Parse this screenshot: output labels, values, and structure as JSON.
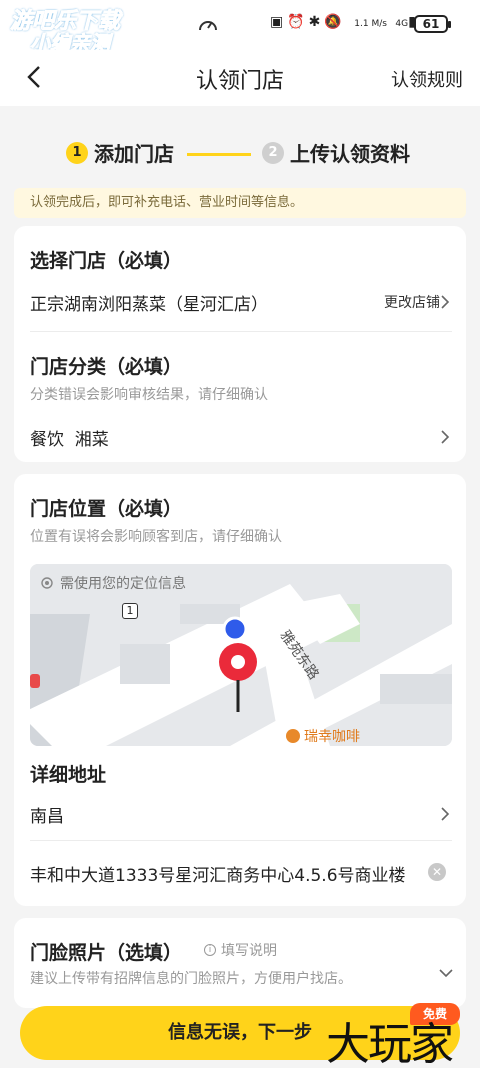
{
  "status_bar": {
    "battery": "61",
    "network": "4G",
    "speed": "1.1 M/s",
    "watermark_line1": "游吧乐下载",
    "watermark_line2": "小编亲测"
  },
  "nav": {
    "title": "认领门店",
    "rules_label": "认领规则"
  },
  "steps": [
    {
      "num": "1",
      "label": "添加门店",
      "active": true
    },
    {
      "num": "2",
      "label": "上传认领资料",
      "active": false
    }
  ],
  "notice": "认领完成后，即可补充电话、营业时间等信息。",
  "store_select": {
    "title": "选择门店（必填）",
    "store_name": "正宗湖南浏阳蒸菜（星河汇店）",
    "change_label": "更改店铺"
  },
  "category": {
    "title": "门店分类（必填）",
    "hint": "分类错误会影响审核结果，请仔细确认",
    "value": "餐饮  湘菜"
  },
  "location": {
    "title": "门店位置（必填）",
    "hint": "位置有误将会影响顾客到店，请仔细确认",
    "map_hint": "需使用您的定位信息",
    "road_label": "雅苑东路",
    "poi_label": "瑞幸咖啡",
    "road_badge": "1",
    "detail_title": "详细地址",
    "city": "南昌",
    "street": "丰和中大道1333号星河汇商务中心4.5.6号商业楼"
  },
  "photo": {
    "title": "门脸照片（选填）",
    "guide_label": "填写说明",
    "hint": "建议上传带有招牌信息的门脸照片，方便用户找店。"
  },
  "footer": {
    "next_label": "信息无误，下一步",
    "free_badge": "免费",
    "brand": "大玩家"
  },
  "colors": {
    "accent": "#ffd31a",
    "pin": "#ea2a3a",
    "user_dot": "#2f5bea"
  }
}
